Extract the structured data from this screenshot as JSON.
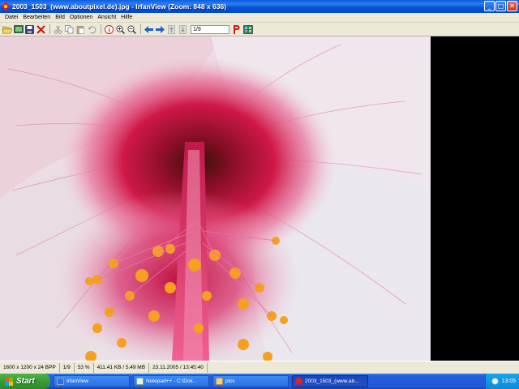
{
  "window": {
    "title": "2003_1503_(www.aboutpixel.de).jpg - IrfanView (Zoom: 848 x 636)",
    "controls": {
      "minimize": "_",
      "maximize": "□",
      "close": "✕"
    }
  },
  "menu": {
    "items": [
      {
        "label": "Datei"
      },
      {
        "label": "Bearbeiten"
      },
      {
        "label": "Bild"
      },
      {
        "label": "Optionen"
      },
      {
        "label": "Ansicht"
      },
      {
        "label": "Hilfe"
      }
    ]
  },
  "toolbar": {
    "buttons": [
      {
        "icon": "open-folder-icon"
      },
      {
        "icon": "slideshow-icon"
      },
      {
        "icon": "save-icon"
      },
      {
        "icon": "delete-icon"
      },
      {
        "icon": "cut-icon"
      },
      {
        "icon": "copy-icon"
      },
      {
        "icon": "paste-icon"
      },
      {
        "icon": "undo-icon"
      },
      {
        "icon": "info-icon"
      },
      {
        "icon": "zoom-in-icon"
      },
      {
        "icon": "zoom-out-icon"
      },
      {
        "icon": "previous-icon"
      },
      {
        "icon": "next-icon"
      },
      {
        "icon": "first-icon"
      },
      {
        "icon": "last-icon"
      }
    ],
    "page_value": "1/9",
    "after_field": [
      {
        "icon": "paint-icon"
      },
      {
        "icon": "thumbnails-icon"
      }
    ]
  },
  "image": {
    "description_alt": "2003_1503_(www.aboutpixel.de).jpg"
  },
  "statusbar": {
    "cells": [
      "1600 x 1200 x 24 BPP",
      "1/9",
      "53 %",
      "411.41 KB / 5.49 MB",
      "23.11.2005 / 13:45:40"
    ]
  },
  "taskbar": {
    "start_label": "Start",
    "tasks": [
      {
        "label": "IrfanView",
        "active": false
      },
      {
        "label": "Notepad++ - C:\\Dok...",
        "active": false
      },
      {
        "label": "pics",
        "active": false
      },
      {
        "label": "2003_1503_(www.ab...",
        "active": true
      }
    ],
    "clock": "13:05"
  },
  "colors": {
    "titlebar": "#0553d6",
    "chrome": "#ece9d8",
    "taskbar": "#245edb",
    "start_green": "#3a9b35"
  }
}
